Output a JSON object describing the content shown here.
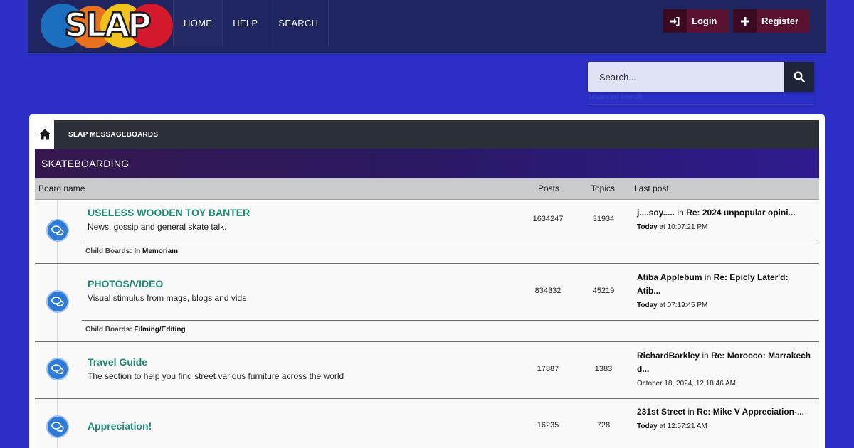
{
  "header": {
    "logo_text": "SLAP",
    "nav": [
      {
        "label": "HOME"
      },
      {
        "label": "HELP"
      },
      {
        "label": "SEARCH"
      }
    ],
    "login_label": "Login",
    "register_label": "Register"
  },
  "search": {
    "placeholder": "Search...",
    "advanced_label": "advanced search"
  },
  "breadcrumb": {
    "item": "SLAP MESSAGEBOARDS"
  },
  "category": {
    "title": "SKATEBOARDING"
  },
  "columns": {
    "board_name": "Board name",
    "posts": "Posts",
    "topics": "Topics",
    "last_post": "Last post"
  },
  "boards": [
    {
      "title": "USELESS WOODEN TOY BANTER",
      "description": "News, gossip and general skate talk.",
      "posts": "1634247",
      "topics": "31934",
      "last_user": "j....soy.....",
      "last_in": "in",
      "last_topic": "Re: 2024 unpopular opini...",
      "last_day": "Today",
      "last_time": "at 10:07:21 PM",
      "child_label": "Child Boards",
      "child_value": "In Memoriam"
    },
    {
      "title": "PHOTOS/VIDEO",
      "description": "Visual stimulus from mags, blogs and vids",
      "posts": "834332",
      "topics": "45219",
      "last_user": "Atiba Applebum",
      "last_in": "in",
      "last_topic": "Re: Epicly Later'd: Atib...",
      "last_day": "Today",
      "last_time": "at 07:19:45 PM",
      "child_label": "Child Boards",
      "child_value": "Filming/Editing"
    },
    {
      "title": "Travel Guide",
      "description": "The section to help you find street various furniture across the world",
      "posts": "17887",
      "topics": "1383",
      "last_user": "RichardBarkley",
      "last_in": "in",
      "last_topic": "Re: Morocco: Marrakech d...",
      "last_datetime": "October 18, 2024, 12:18:46 AM"
    },
    {
      "title": "Appreciation!",
      "posts": "16235",
      "topics": "728",
      "last_user": "231st Street",
      "last_in": "in",
      "last_topic": "Re: Mike V Appreciation-...",
      "last_day": "Today",
      "last_time": "at 12:57:21 AM"
    }
  ]
}
